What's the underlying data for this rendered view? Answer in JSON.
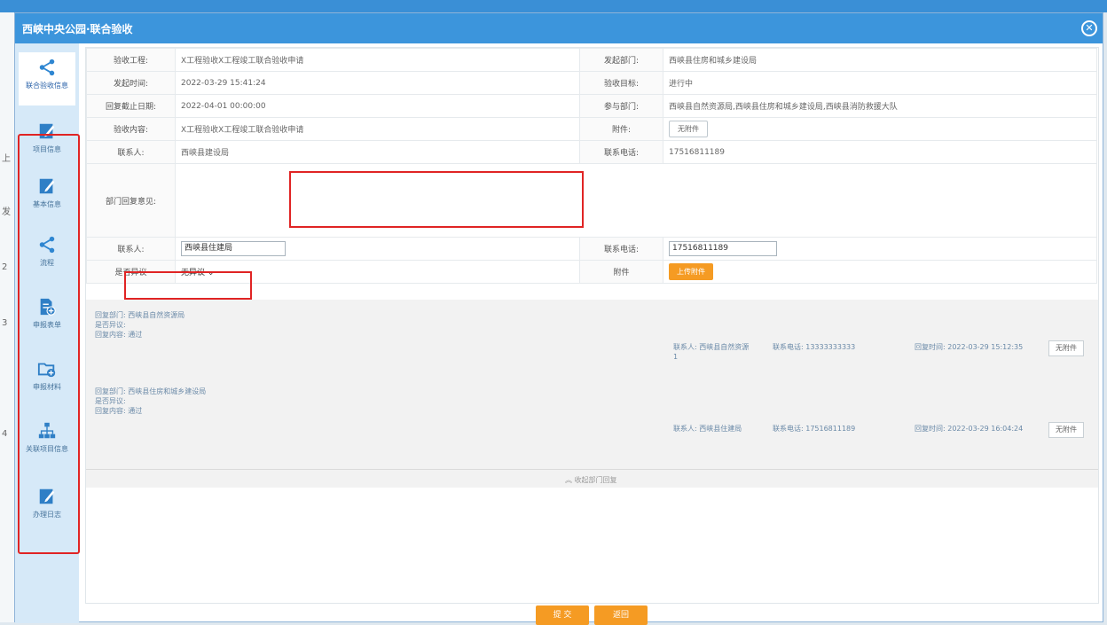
{
  "background": {
    "top_text": "",
    "left_marks": [
      "上",
      "发",
      "2",
      "3",
      "4"
    ]
  },
  "dialog": {
    "title": "西峡中央公园·联合验收",
    "close_icon": "close-icon"
  },
  "sidebar": {
    "items": [
      {
        "label": "联合验收信息",
        "icon": "share-icon"
      },
      {
        "label": "项目信息",
        "icon": "edit-icon"
      },
      {
        "label": "基本信息",
        "icon": "edit-icon"
      },
      {
        "label": "流程",
        "icon": "share-icon"
      },
      {
        "label": "申报表单",
        "icon": "document-icon"
      },
      {
        "label": "申报材料",
        "icon": "folder-icon"
      },
      {
        "label": "关联项目信息",
        "icon": "tree-icon"
      },
      {
        "label": "办理日志",
        "icon": "edit-icon"
      }
    ]
  },
  "info": {
    "row1": {
      "label": "验收工程:",
      "value": "X工程验收X工程竣工联合验收申请",
      "label2": "发起部门:",
      "value2": "西峡县住房和城乡建设局"
    },
    "row2": {
      "label": "发起时间:",
      "value": "2022-03-29 15:41:24",
      "label2": "验收目标:",
      "value2": "进行中"
    },
    "row3": {
      "label": "回复截止日期:",
      "value": "2022-04-01 00:00:00",
      "label2": "参与部门:",
      "value2": "西峡县自然资源局,西峡县住房和城乡建设局,西峡县消防救援大队"
    },
    "row4": {
      "label": "验收内容:",
      "value": "X工程验收X工程竣工联合验收申请",
      "label2": "附件:",
      "button2": "无附件"
    },
    "row5": {
      "label": "联系人:",
      "value": "西峡县建设局",
      "label2": "联系电话:",
      "value2": "17516811189"
    }
  },
  "form": {
    "opinion_label": "部门回复意见:",
    "contact_label": "联系人:",
    "contact_value": "西峡县住建局",
    "phone_label": "联系电话:",
    "phone_value": "17516811189",
    "objection_label": "是否异议",
    "objection_value": "无异议",
    "attachment_label": "附件",
    "upload_button": "上传附件"
  },
  "records": [
    {
      "dept": "回复部门: 西峡县自然资源局",
      "objection": "是否异议:",
      "content": "回复内容: 通过",
      "contact": "联系人: 西峡县自然资源",
      "phone": "联系电话: 13333333333",
      "time": "回复时间: 2022-03-29 15:12:35",
      "time_tail": "1",
      "button": "无附件"
    },
    {
      "dept": "回复部门: 西峡县住房和城乡建设局",
      "objection": "是否异议:",
      "content": "回复内容: 通过",
      "contact": "联系人: 西峡县住建局",
      "phone": "联系电话: 17516811189",
      "time": "回复时间: 2022-03-29 16:04:24",
      "button": "无附件"
    }
  ],
  "collapse_text": "收起部门回复",
  "footer": {
    "submit": "提 交",
    "back": "返回"
  },
  "colors": {
    "title_blue": "#3c95dc",
    "orange": "#f59b23",
    "highlight_red": "#e02424"
  }
}
